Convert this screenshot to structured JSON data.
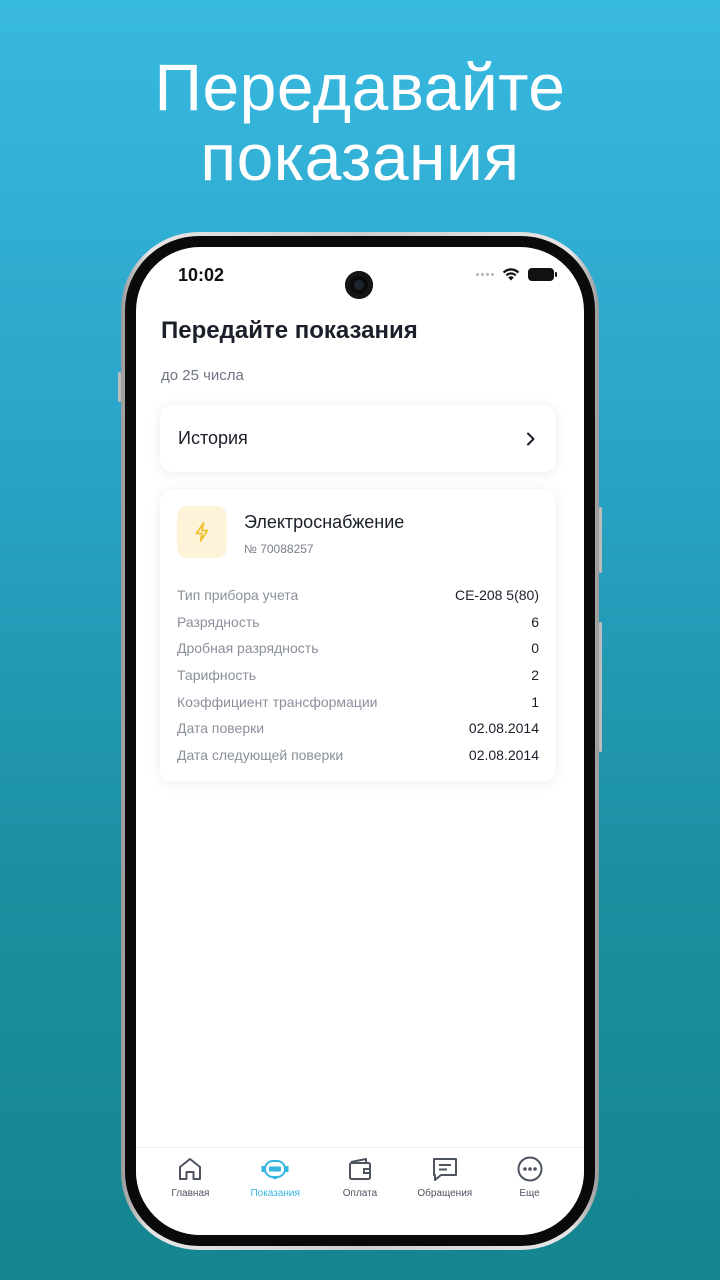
{
  "promo": {
    "headline_line1": "Передавайте",
    "headline_line2": "показания"
  },
  "status_bar": {
    "time": "10:02"
  },
  "page": {
    "title": "Передайте показания",
    "subtitle": "до 25 числа"
  },
  "history": {
    "label": "История"
  },
  "meter": {
    "name": "Электроснабжение",
    "number": "№ 70088257",
    "icon": "lightning-icon",
    "icon_bg": "#fdf3d9",
    "icon_color": "#f2c12e",
    "rows": [
      {
        "label": "Тип прибора учета",
        "value": "CE-208 5(80)"
      },
      {
        "label": "Разрядность",
        "value": "6"
      },
      {
        "label": "Дробная разрядность",
        "value": "0"
      },
      {
        "label": "Тарифность",
        "value": "2"
      },
      {
        "label": "Коэффициент трансформации",
        "value": "1"
      },
      {
        "label": "Дата поверки",
        "value": "02.08.2014"
      },
      {
        "label": "Дата следующей поверки",
        "value": "02.08.2014"
      }
    ]
  },
  "tabbar": {
    "accent": "#35b5df",
    "items": [
      {
        "label": "Главная",
        "icon": "home-icon",
        "active": false
      },
      {
        "label": "Показания",
        "icon": "meter-icon",
        "active": true
      },
      {
        "label": "Оплата",
        "icon": "wallet-icon",
        "active": false
      },
      {
        "label": "Обращения",
        "icon": "chat-icon",
        "active": false
      },
      {
        "label": "Еще",
        "icon": "more-icon",
        "active": false
      }
    ]
  }
}
